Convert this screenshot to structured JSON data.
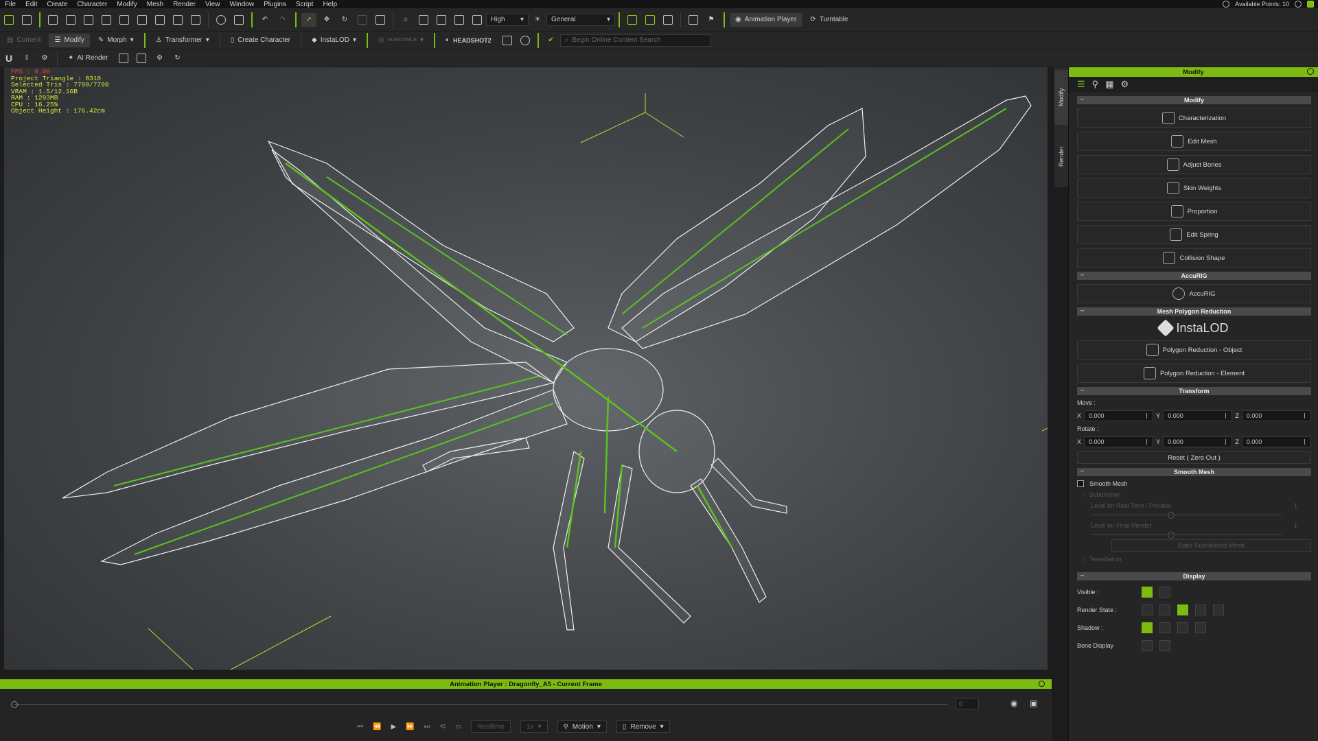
{
  "menu": [
    "File",
    "Edit",
    "Create",
    "Character",
    "Modify",
    "Mesh",
    "Render",
    "View",
    "Window",
    "Plugins",
    "Script",
    "Help"
  ],
  "account": {
    "available_points": "Available Points: 10"
  },
  "toolbar1": {
    "quality_select": "High",
    "view_select": "General",
    "animation_player": "Animation Player",
    "turntable": "Turntable"
  },
  "toolbar2": {
    "content": "Content",
    "modify": "Modify",
    "morph": "Morph",
    "transformer": "Transformer",
    "create_character": "Create Character",
    "instalod": "InstaLOD",
    "substance": "SUBSTANCE",
    "headshot": "HEADSHOT2",
    "search_placeholder": "Begin Online Content Search"
  },
  "toolbar3": {
    "ai_render": "AI Render"
  },
  "stats": {
    "fps": "FPS : 0.00",
    "project_triangle": "Project Triangle : 8310",
    "selected_tris": "Selected Tris : 7790/7790",
    "vram": "VRAM : 1.5/12.1GB",
    "ram": "RAM : 1293MB",
    "cpu": "CPU : 16.25%",
    "object_height": "Object Height : 176.42cm"
  },
  "sidetabs": {
    "modify": "Modify",
    "render": "Render"
  },
  "panel": {
    "title": "Modify",
    "sections": {
      "modify": "Modify",
      "accurig": "AccuRIG",
      "mesh_polygon_reduction": "Mesh Polygon Reduction",
      "transform": "Transform",
      "smooth_mesh": "Smooth Mesh",
      "display": "Display"
    },
    "modify_buttons": [
      "Characterization",
      "Edit Mesh",
      "Adjust Bones",
      "Skin Weights",
      "Proportion",
      "Edit Spring",
      "Collision Shape"
    ],
    "accurig_button": "AccuRIG",
    "instalod_logo": "InstaLOD",
    "reduction_buttons": [
      "Polygon Reduction - Object",
      "Polygon Reduction - Element"
    ],
    "transform": {
      "move_label": "Move :",
      "rotate_label": "Rotate :",
      "x": "X",
      "y": "Y",
      "z": "Z",
      "move": {
        "x": "0.000",
        "y": "0.000",
        "z": "0.000"
      },
      "rotate": {
        "x": "0.000",
        "y": "0.000",
        "z": "0.000"
      },
      "reset": "Reset ( Zero Out )"
    },
    "smooth": {
      "checkbox_label": "Smooth Mesh",
      "subdivision": "Subdivision",
      "level_realtime": "Level for Real Time / Preview",
      "level_final": "Level for Final Render",
      "level_value": "1",
      "bake": "Bake Subdivided Mesh",
      "tessellation": "Tessellation"
    },
    "display": {
      "visible": "Visible :",
      "render_state": "Render State :",
      "shadow": "Shadow :",
      "bone_display": "Bone Display"
    }
  },
  "animation": {
    "title": "Animation Player : Dragonfly_A5 - Current Frame",
    "frame": "0",
    "realtime": "Realtime",
    "speed": "1x",
    "motion": "Motion",
    "remove": "Remove"
  }
}
